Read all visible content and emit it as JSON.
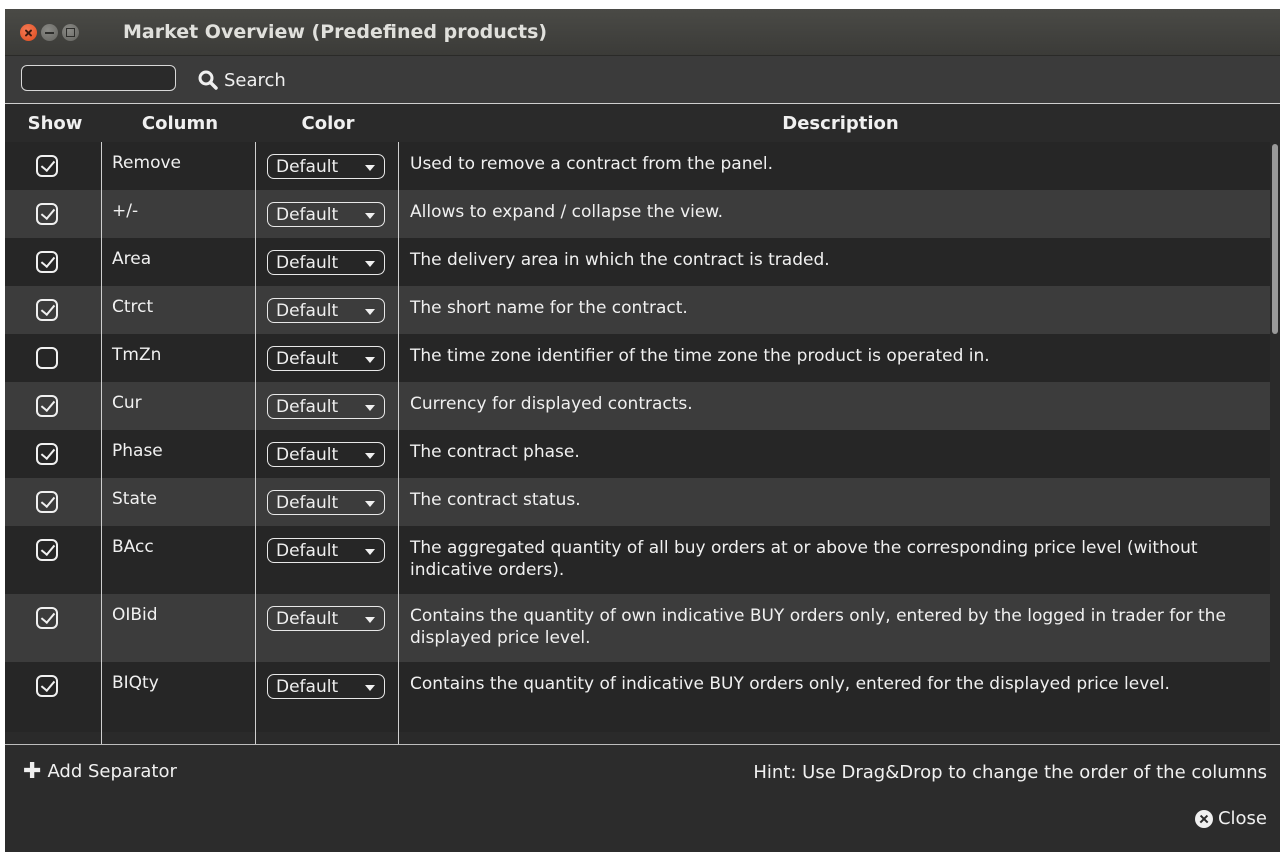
{
  "window": {
    "title": "Market Overview (Predefined products)"
  },
  "search": {
    "value": "",
    "button_label": "Search"
  },
  "table": {
    "headers": {
      "show": "Show",
      "column": "Column",
      "color": "Color",
      "description": "Description"
    },
    "rows": [
      {
        "show": true,
        "column": "Remove",
        "color": "Default",
        "description": "Used to remove a contract from the panel."
      },
      {
        "show": true,
        "column": "+/-",
        "color": "Default",
        "description": "Allows to expand / collapse the view."
      },
      {
        "show": true,
        "column": "Area",
        "color": "Default",
        "description": "The delivery area in which the contract is traded."
      },
      {
        "show": true,
        "column": "Ctrct",
        "color": "Default",
        "description": "The short name for the contract."
      },
      {
        "show": false,
        "column": "TmZn",
        "color": "Default",
        "description": "The time zone identifier of the time zone the product is operated in."
      },
      {
        "show": true,
        "column": "Cur",
        "color": "Default",
        "description": "Currency for displayed contracts."
      },
      {
        "show": true,
        "column": "Phase",
        "color": "Default",
        "description": "The contract phase."
      },
      {
        "show": true,
        "column": "State",
        "color": "Default",
        "description": "The contract status."
      },
      {
        "show": true,
        "column": "BAcc",
        "color": "Default",
        "description": "The aggregated quantity of all buy orders at or above the corresponding price level (without indicative orders)."
      },
      {
        "show": true,
        "column": "OIBid",
        "color": "Default",
        "description": "Contains the quantity of own indicative BUY orders only, entered by the logged in trader for the displayed price level."
      },
      {
        "show": true,
        "column": "BIQty",
        "color": "Default",
        "description": "Contains the quantity of indicative BUY orders only, entered for the displayed price level."
      }
    ]
  },
  "footer": {
    "add_separator_label": "Add Separator",
    "hint": "Hint: Use Drag&Drop to change the order of the columns",
    "close_label": "Close"
  },
  "icons": {
    "search": "search-icon",
    "add": "plus-icon",
    "close": "close-circle-icon",
    "dropdown": "chevron-down-icon",
    "checkbox": "checkbox-icon"
  }
}
